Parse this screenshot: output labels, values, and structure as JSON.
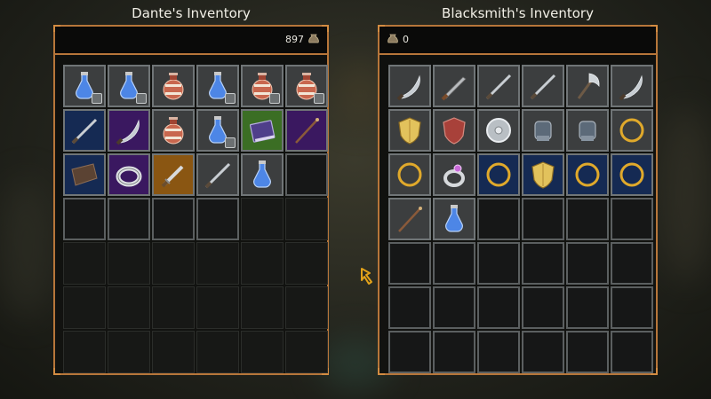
{
  "left_panel": {
    "title": "Dante's Inventory",
    "gold": "897",
    "slots": [
      {
        "item": "blue-potion-icon",
        "bg": "filled",
        "stack": true
      },
      {
        "item": "blue-potion-icon",
        "bg": "filled",
        "stack": true
      },
      {
        "item": "red-potion-icon",
        "bg": "filled",
        "stack": false
      },
      {
        "item": "blue-potion-icon",
        "bg": "filled",
        "stack": true
      },
      {
        "item": "red-potion-icon",
        "bg": "filled",
        "stack": true
      },
      {
        "item": "red-potion-icon",
        "bg": "filled",
        "stack": true
      },
      {
        "item": "sword-icon",
        "bg": "blue",
        "stack": false
      },
      {
        "item": "scimitar-icon",
        "bg": "purple",
        "stack": false
      },
      {
        "item": "red-potion-icon",
        "bg": "filled",
        "stack": false
      },
      {
        "item": "blue-potion-icon",
        "bg": "filled",
        "stack": true
      },
      {
        "item": "spellbook-icon",
        "bg": "green",
        "stack": false
      },
      {
        "item": "staff-icon",
        "bg": "purple",
        "stack": false
      },
      {
        "item": "leather-icon",
        "bg": "blue",
        "stack": false
      },
      {
        "item": "ring-icon",
        "bg": "purple",
        "stack": false
      },
      {
        "item": "shortsword-icon",
        "bg": "orange",
        "stack": false
      },
      {
        "item": "sword-icon",
        "bg": "filled",
        "stack": false
      },
      {
        "item": "blue-potion-icon",
        "bg": "filled",
        "stack": false
      },
      {
        "item": "",
        "bg": "bordered",
        "stack": false
      },
      {
        "item": "",
        "bg": "bordered",
        "stack": false
      },
      {
        "item": "",
        "bg": "bordered",
        "stack": false
      },
      {
        "item": "",
        "bg": "bordered",
        "stack": false
      },
      {
        "item": "",
        "bg": "bordered",
        "stack": false
      },
      {
        "item": "",
        "bg": "empty",
        "stack": false
      },
      {
        "item": "",
        "bg": "empty",
        "stack": false
      },
      {
        "item": "",
        "bg": "empty",
        "stack": false
      },
      {
        "item": "",
        "bg": "empty",
        "stack": false
      },
      {
        "item": "",
        "bg": "empty",
        "stack": false
      },
      {
        "item": "",
        "bg": "empty",
        "stack": false
      },
      {
        "item": "",
        "bg": "empty",
        "stack": false
      },
      {
        "item": "",
        "bg": "empty",
        "stack": false
      },
      {
        "item": "",
        "bg": "empty",
        "stack": false
      },
      {
        "item": "",
        "bg": "empty",
        "stack": false
      },
      {
        "item": "",
        "bg": "empty",
        "stack": false
      },
      {
        "item": "",
        "bg": "empty",
        "stack": false
      },
      {
        "item": "",
        "bg": "empty",
        "stack": false
      },
      {
        "item": "",
        "bg": "empty",
        "stack": false
      },
      {
        "item": "",
        "bg": "empty",
        "stack": false
      },
      {
        "item": "",
        "bg": "empty",
        "stack": false
      },
      {
        "item": "",
        "bg": "empty",
        "stack": false
      },
      {
        "item": "",
        "bg": "empty",
        "stack": false
      },
      {
        "item": "",
        "bg": "empty",
        "stack": false
      },
      {
        "item": "",
        "bg": "empty",
        "stack": false
      }
    ]
  },
  "right_panel": {
    "title": "Blacksmith's Inventory",
    "gold": "0",
    "slots": [
      {
        "item": "scimitar-icon",
        "bg": "filled"
      },
      {
        "item": "serrated-sword-icon",
        "bg": "filled"
      },
      {
        "item": "sword-icon",
        "bg": "filled"
      },
      {
        "item": "sword-icon",
        "bg": "filled"
      },
      {
        "item": "axe-icon",
        "bg": "filled"
      },
      {
        "item": "scimitar-icon",
        "bg": "filled"
      },
      {
        "item": "gold-shield-icon",
        "bg": "filled"
      },
      {
        "item": "red-shield-icon",
        "bg": "filled"
      },
      {
        "item": "round-shield-icon",
        "bg": "filled"
      },
      {
        "item": "gauntlet-icon",
        "bg": "filled"
      },
      {
        "item": "gauntlet-icon",
        "bg": "filled"
      },
      {
        "item": "gold-ring-icon",
        "bg": "filled"
      },
      {
        "item": "gold-ring-icon",
        "bg": "filled"
      },
      {
        "item": "silver-ring-icon",
        "bg": "filled"
      },
      {
        "item": "gold-ring-icon",
        "bg": "blue"
      },
      {
        "item": "gold-shield-icon",
        "bg": "blue"
      },
      {
        "item": "gold-ring-icon",
        "bg": "blue"
      },
      {
        "item": "gold-ring-icon",
        "bg": "blue"
      },
      {
        "item": "staff-icon",
        "bg": "filled"
      },
      {
        "item": "blue-potion-icon",
        "bg": "filled"
      },
      {
        "item": "",
        "bg": "bordered"
      },
      {
        "item": "",
        "bg": "bordered"
      },
      {
        "item": "",
        "bg": "bordered"
      },
      {
        "item": "",
        "bg": "bordered"
      },
      {
        "item": "",
        "bg": "bordered"
      },
      {
        "item": "",
        "bg": "bordered"
      },
      {
        "item": "",
        "bg": "bordered"
      },
      {
        "item": "",
        "bg": "bordered"
      },
      {
        "item": "",
        "bg": "bordered"
      },
      {
        "item": "",
        "bg": "bordered"
      },
      {
        "item": "",
        "bg": "bordered"
      },
      {
        "item": "",
        "bg": "bordered"
      },
      {
        "item": "",
        "bg": "bordered"
      },
      {
        "item": "",
        "bg": "bordered"
      },
      {
        "item": "",
        "bg": "bordered"
      },
      {
        "item": "",
        "bg": "bordered"
      },
      {
        "item": "",
        "bg": "bordered"
      },
      {
        "item": "",
        "bg": "bordered"
      },
      {
        "item": "",
        "bg": "bordered"
      },
      {
        "item": "",
        "bg": "bordered"
      },
      {
        "item": "",
        "bg": "bordered"
      },
      {
        "item": "",
        "bg": "bordered"
      }
    ]
  },
  "colors": {
    "frame": "#b7763a",
    "rarity_blue": "#152a53",
    "rarity_purple": "#3a1860",
    "rarity_green": "#3b6e24",
    "rarity_orange": "#8a5612",
    "cursor": "#e2a21a"
  },
  "cursor": {
    "icon": "hand-cursor-icon"
  }
}
